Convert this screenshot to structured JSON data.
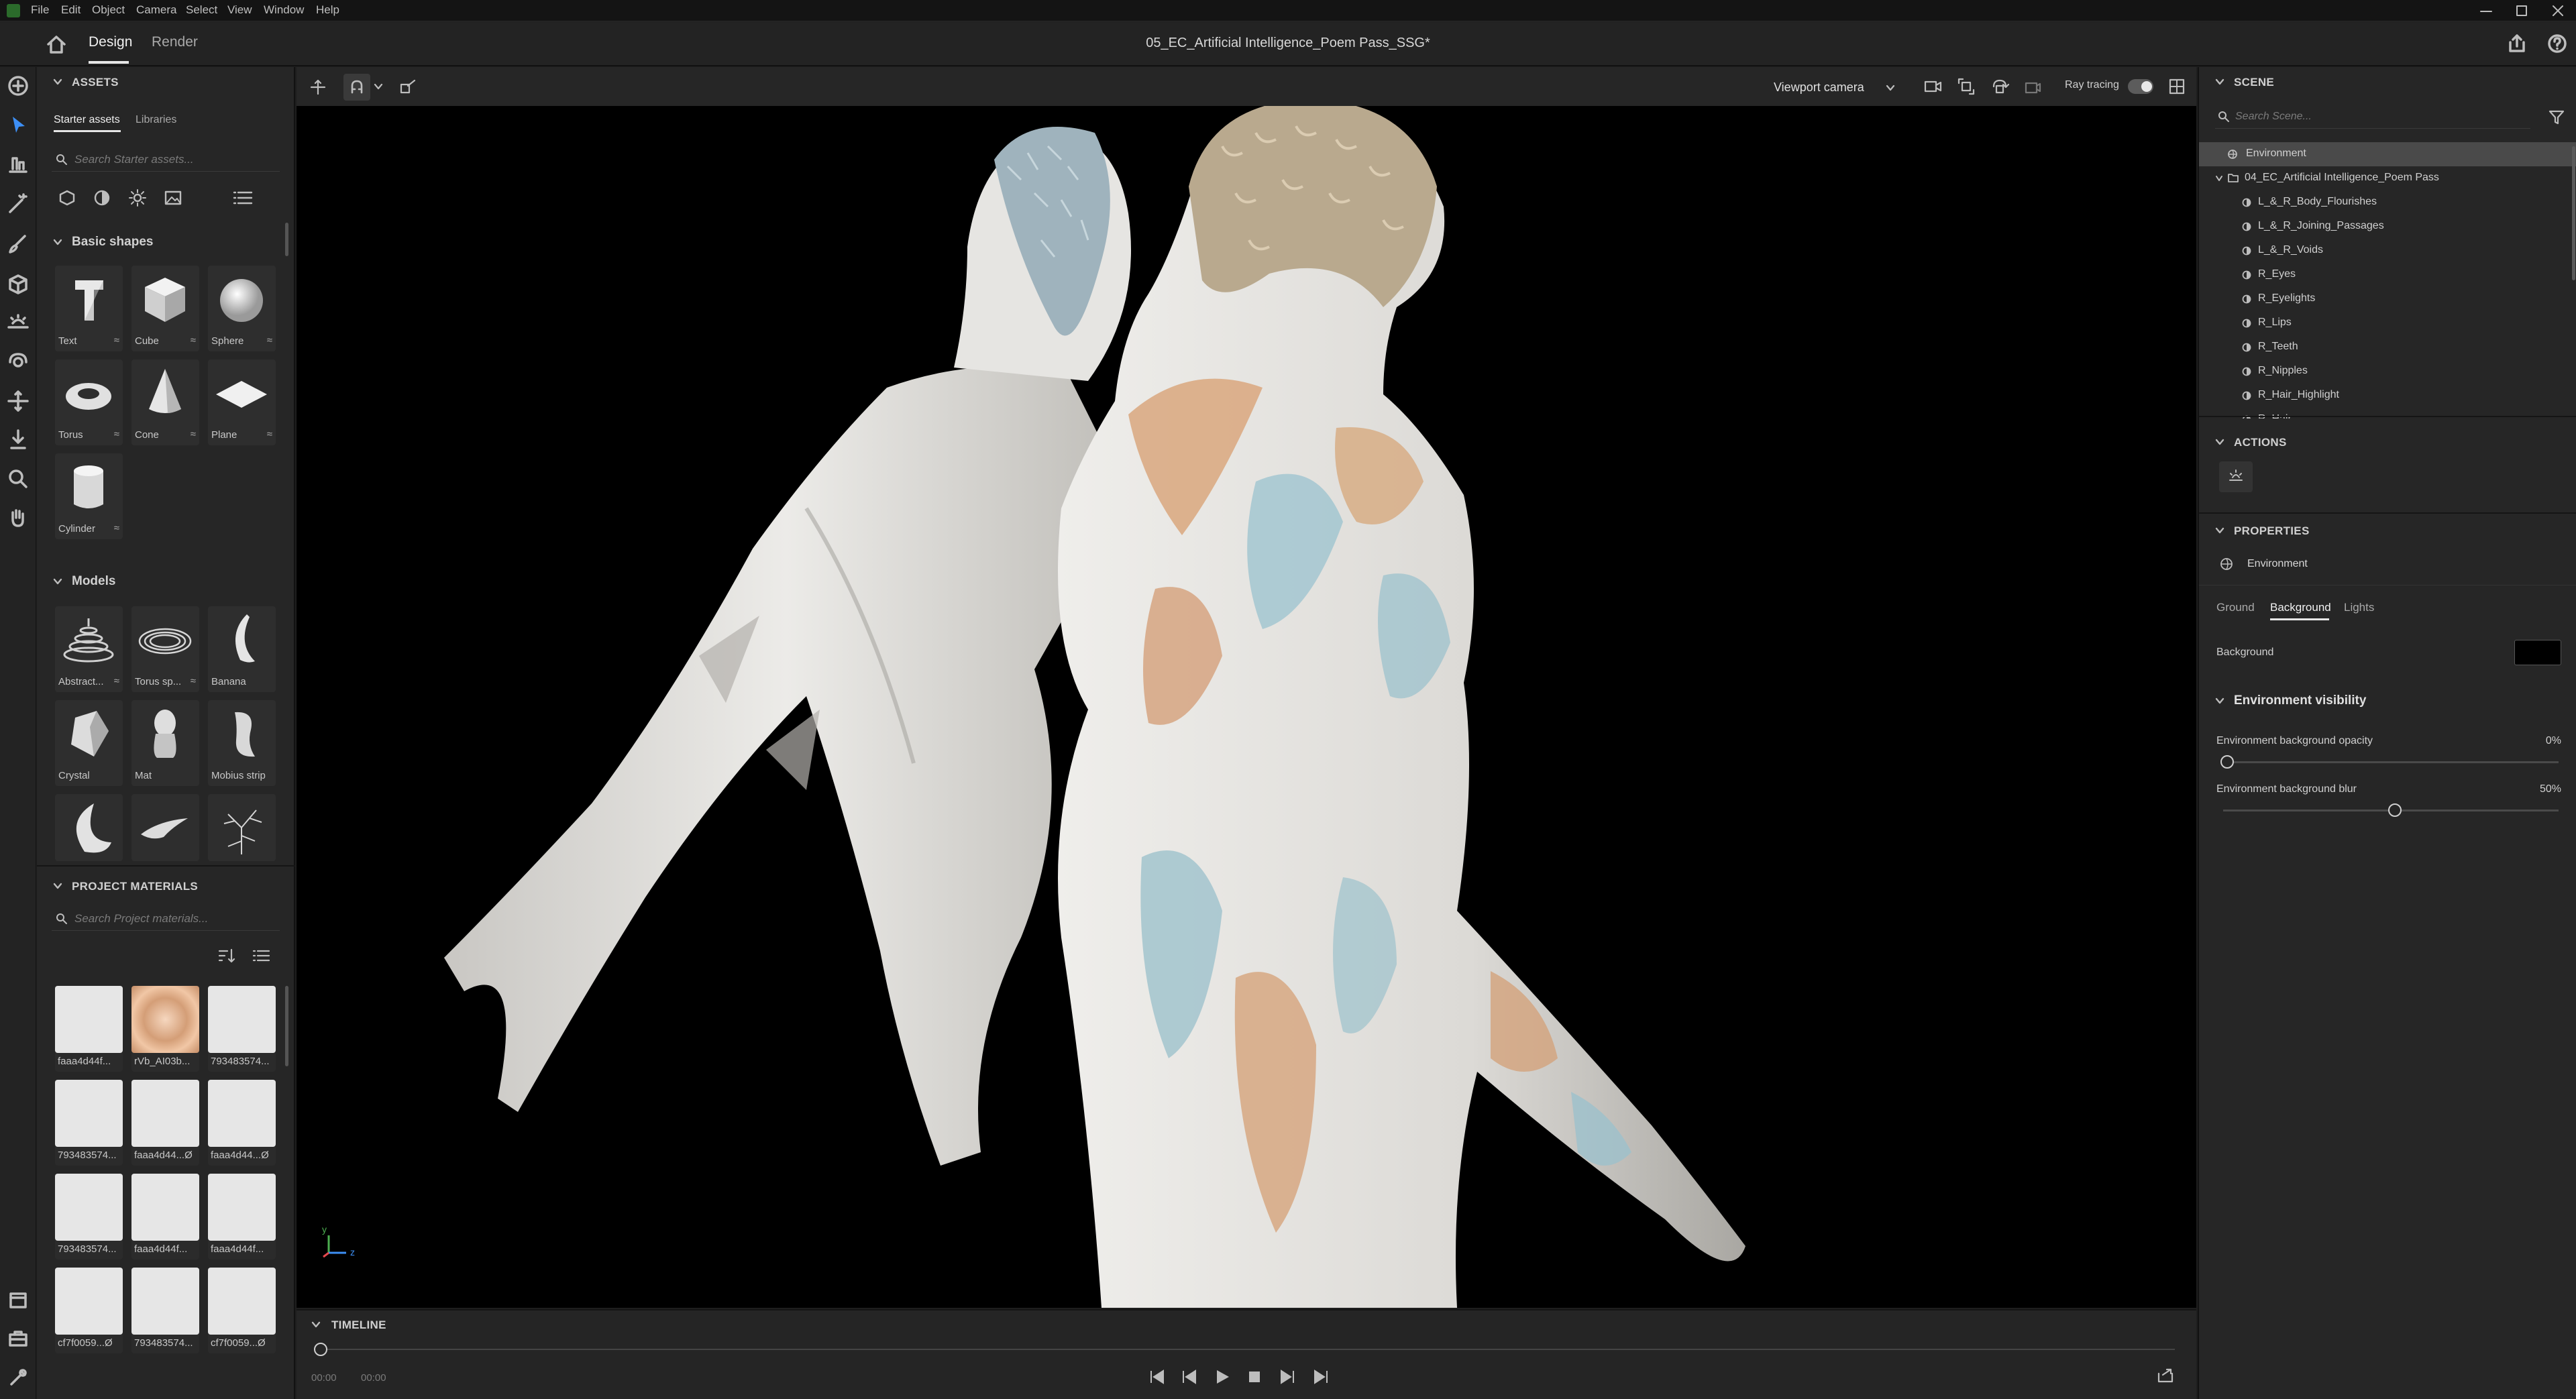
{
  "app": {
    "menu": [
      "File",
      "Edit",
      "Object",
      "Camera",
      "Select",
      "View",
      "Window",
      "Help"
    ],
    "tabs": [
      "Design",
      "Render"
    ],
    "document_title": "05_EC_Artificial Intelligence_Poem Pass_SSG*"
  },
  "assets": {
    "header": "ASSETS",
    "tabs": [
      "Starter assets",
      "Libraries"
    ],
    "search_placeholder": "Search Starter assets...",
    "basic_shapes_title": "Basic shapes",
    "basic_shapes": [
      "Text",
      "Cube",
      "Sphere",
      "Torus",
      "Cone",
      "Plane",
      "Cylinder"
    ],
    "models_title": "Models",
    "models": [
      "Abstract...",
      "Torus sp...",
      "Banana",
      "Crystal",
      "Mat",
      "Mobius strip",
      "",
      "",
      ""
    ]
  },
  "project_materials": {
    "header": "PROJECT MATERIALS",
    "search_placeholder": "Search Project materials...",
    "items": [
      "faaa4d44f...",
      "rVb_AI03b...",
      "793483574...",
      "793483574...",
      "faaa4d44...Ø",
      "faaa4d44...Ø",
      "793483574...",
      "faaa4d44f...",
      "faaa4d44f...",
      "cf7f0059...Ø",
      "793483574...",
      "cf7f0059...Ø"
    ]
  },
  "viewport": {
    "camera_select": "Viewport camera",
    "ray_tracing_label": "Ray tracing",
    "ray_tracing_on": false,
    "axis_y": "y",
    "axis_z": "z"
  },
  "timeline": {
    "header": "TIMELINE",
    "time_start": "00:00",
    "time_end": "00:00"
  },
  "scene": {
    "header": "SCENE",
    "search_placeholder": "Search Scene...",
    "environment": "Environment",
    "group": "04_EC_Artificial Intelligence_Poem Pass",
    "children": [
      "L_&_R_Body_Flourishes",
      "L_&_R_Joining_Passages",
      "L_&_R_Voids",
      "R_Eyes",
      "R_Eyelights",
      "R_Lips",
      "R_Teeth",
      "R_Nipples",
      "R_Hair_Highlight",
      "R_Hair"
    ]
  },
  "actions": {
    "header": "ACTIONS"
  },
  "properties": {
    "header": "PROPERTIES",
    "selected": "Environment",
    "tabs": [
      "Ground",
      "Background",
      "Lights"
    ],
    "active_tab": "Background",
    "background_label": "Background",
    "background_color": "#000000",
    "visibility_title": "Environment visibility",
    "opacity_label": "Environment background opacity",
    "opacity_value": "0%",
    "opacity_fraction": 0,
    "blur_label": "Environment background blur",
    "blur_value": "50%",
    "blur_fraction": 0.5
  },
  "colors": {
    "accent": "#1473e6",
    "panel": "#262626",
    "viewport_bg": "#000000"
  }
}
